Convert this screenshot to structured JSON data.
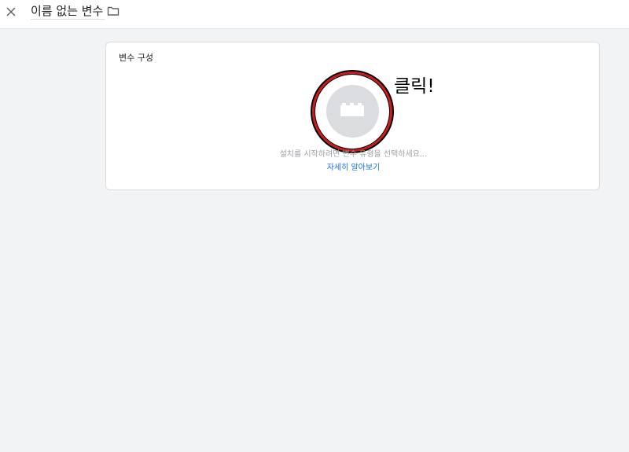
{
  "header": {
    "title": "이름 없는 변수",
    "close_icon": "close-icon",
    "folder_icon": "folder-icon"
  },
  "config_card": {
    "title": "변수 구성",
    "type_icon": "puzzle-brick-icon",
    "hint": "설치를 시작하려면 변수 유형을 선택하세요...",
    "learn_more": "자세히 알아보기"
  },
  "annotation": {
    "text": "클릭!",
    "ring_color": "#d21a1a"
  },
  "colors": {
    "background": "#f1f3f4",
    "link": "#1a73e8"
  }
}
